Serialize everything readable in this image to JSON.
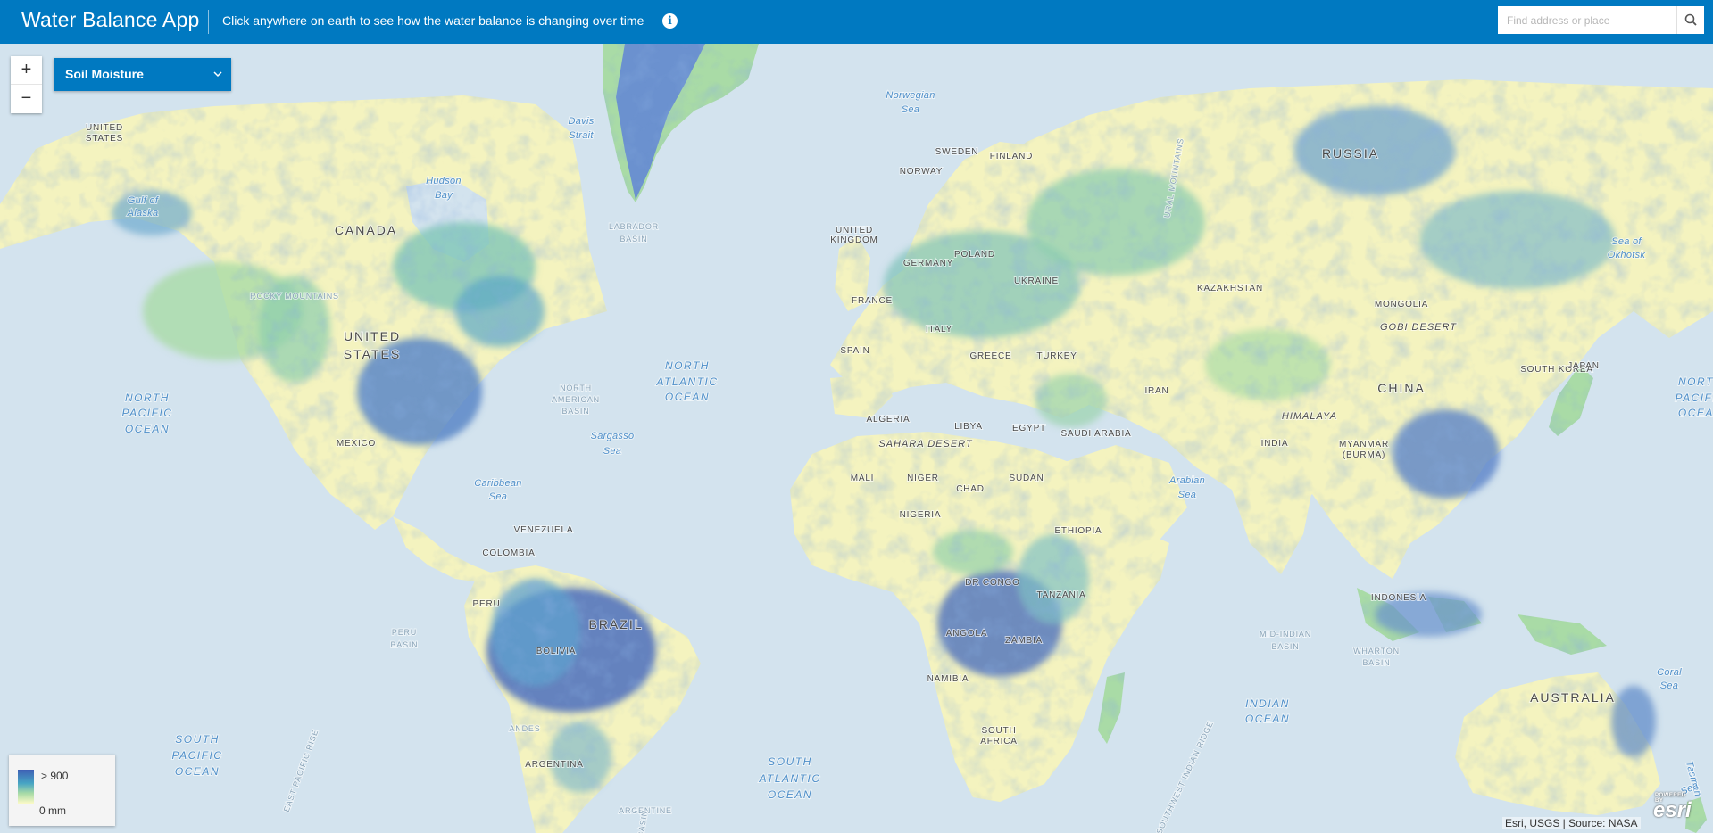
{
  "header": {
    "title": "Water Balance App",
    "subtitle": "Click anywhere on earth to see how the water balance is changing over time",
    "search_placeholder": "Find address or place"
  },
  "controls": {
    "zoom_in": "+",
    "zoom_out": "−",
    "layer_select": "Soil Moisture"
  },
  "legend": {
    "max_label": "> 900",
    "min_label": "0 mm"
  },
  "attribution": "Esri, USGS | Source: NASA",
  "logo": {
    "text": "esri",
    "small": "POWERED BY"
  },
  "colors": {
    "header": "#0079c1",
    "water": "#d3e3ee",
    "dry": "#fbf7c4",
    "moist": "#a9dba6",
    "wet": "#4d9fcb",
    "very_wet": "#3f63b6"
  },
  "map_labels": [
    {
      "t": "UNITED",
      "k": "country"
    },
    {
      "t": "STATES",
      "k": "country"
    },
    {
      "t": "Davis",
      "k": "water"
    },
    {
      "t": "Strait",
      "k": "water"
    },
    {
      "t": "Norwegian",
      "k": "water"
    },
    {
      "t": "Sea",
      "k": "water"
    },
    {
      "t": "Gulf of",
      "k": "water"
    },
    {
      "t": "Alaska",
      "k": "water"
    },
    {
      "t": "Hudson",
      "k": "water"
    },
    {
      "t": "Bay",
      "k": "water"
    },
    {
      "t": "CANADA",
      "k": "big"
    },
    {
      "t": "LABRADOR",
      "k": "basin"
    },
    {
      "t": "BASIN",
      "k": "basin"
    },
    {
      "t": "SWEDEN",
      "k": "country"
    },
    {
      "t": "FINLAND",
      "k": "country"
    },
    {
      "t": "NORWAY",
      "k": "country"
    },
    {
      "t": "RUSSIA",
      "k": "big"
    },
    {
      "t": "UNITED",
      "k": "country"
    },
    {
      "t": "KINGDOM",
      "k": "country"
    },
    {
      "t": "GERMANY",
      "k": "country"
    },
    {
      "t": "POLAND",
      "k": "country"
    },
    {
      "t": "UKRAINE",
      "k": "country"
    },
    {
      "t": "FRANCE",
      "k": "country"
    },
    {
      "t": "ITALY",
      "k": "country"
    },
    {
      "t": "SPAIN",
      "k": "country"
    },
    {
      "t": "GREECE",
      "k": "country"
    },
    {
      "t": "TURKEY",
      "k": "country"
    },
    {
      "t": "KAZAKHSTAN",
      "k": "country"
    },
    {
      "t": "MONGOLIA",
      "k": "country"
    },
    {
      "t": "GOBI DESERT",
      "k": "desert"
    },
    {
      "t": "Sea of",
      "k": "water"
    },
    {
      "t": "Okhotsk",
      "k": "water"
    },
    {
      "t": "SOUTH KOREA",
      "k": "country"
    },
    {
      "t": "JAPAN",
      "k": "country"
    },
    {
      "t": "CHINA",
      "k": "big"
    },
    {
      "t": "UNITED",
      "k": "big"
    },
    {
      "t": "STATES",
      "k": "big"
    },
    {
      "t": "NORTH",
      "k": "ocean"
    },
    {
      "t": "PACIFIC",
      "k": "ocean"
    },
    {
      "t": "OCEAN",
      "k": "ocean"
    },
    {
      "t": "NORTH",
      "k": "ocean"
    },
    {
      "t": "ATLANTIC",
      "k": "ocean"
    },
    {
      "t": "OCEAN",
      "k": "ocean"
    },
    {
      "t": "NORTH",
      "k": "basin"
    },
    {
      "t": "AMERICAN",
      "k": "basin"
    },
    {
      "t": "BASIN",
      "k": "basin"
    },
    {
      "t": "Sargasso",
      "k": "water"
    },
    {
      "t": "Sea",
      "k": "water"
    },
    {
      "t": "MEXICO",
      "k": "country"
    },
    {
      "t": "Caribbean",
      "k": "water"
    },
    {
      "t": "Sea",
      "k": "water"
    },
    {
      "t": "ALGERIA",
      "k": "country"
    },
    {
      "t": "LIBYA",
      "k": "country"
    },
    {
      "t": "EGYPT",
      "k": "country"
    },
    {
      "t": "SAHARA DESERT",
      "k": "desert"
    },
    {
      "t": "SAUDI ARABIA",
      "k": "country"
    },
    {
      "t": "IRAN",
      "k": "country"
    },
    {
      "t": "HIMALAYA",
      "k": "desert"
    },
    {
      "t": "INDIA",
      "k": "country"
    },
    {
      "t": "MYANMAR",
      "k": "country"
    },
    {
      "t": "(BURMA)",
      "k": "country"
    },
    {
      "t": "MALI",
      "k": "country"
    },
    {
      "t": "NIGER",
      "k": "country"
    },
    {
      "t": "CHAD",
      "k": "country"
    },
    {
      "t": "SUDAN",
      "k": "country"
    },
    {
      "t": "NIGERIA",
      "k": "country"
    },
    {
      "t": "ETHIOPIA",
      "k": "country"
    },
    {
      "t": "Arabian",
      "k": "water"
    },
    {
      "t": "Sea",
      "k": "water"
    },
    {
      "t": "VENEZUELA",
      "k": "country"
    },
    {
      "t": "COLOMBIA",
      "k": "country"
    },
    {
      "t": "PERU",
      "k": "country"
    },
    {
      "t": "BRAZIL",
      "k": "big"
    },
    {
      "t": "BOLIVIA",
      "k": "country"
    },
    {
      "t": "DR CONGO",
      "k": "country"
    },
    {
      "t": "TANZANIA",
      "k": "country"
    },
    {
      "t": "ANGOLA",
      "k": "country"
    },
    {
      "t": "ZAMBIA",
      "k": "country"
    },
    {
      "t": "NAMIBIA",
      "k": "country"
    },
    {
      "t": "SOUTH",
      "k": "country"
    },
    {
      "t": "AFRICA",
      "k": "country"
    },
    {
      "t": "INDONESIA",
      "k": "country"
    },
    {
      "t": "MID-INDIAN",
      "k": "basin"
    },
    {
      "t": "BASIN",
      "k": "basin"
    },
    {
      "t": "WHARTON",
      "k": "basin"
    },
    {
      "t": "BASIN",
      "k": "basin"
    },
    {
      "t": "Coral",
      "k": "water"
    },
    {
      "t": "Sea",
      "k": "water"
    },
    {
      "t": "AUSTRALIA",
      "k": "big"
    },
    {
      "t": "INDIAN",
      "k": "ocean"
    },
    {
      "t": "OCEAN",
      "k": "ocean"
    },
    {
      "t": "PERU",
      "k": "basin"
    },
    {
      "t": "BASIN",
      "k": "basin"
    },
    {
      "t": "SOUTH",
      "k": "ocean"
    },
    {
      "t": "PACIFIC",
      "k": "ocean"
    },
    {
      "t": "OCEAN",
      "k": "ocean"
    },
    {
      "t": "SOUTH",
      "k": "ocean"
    },
    {
      "t": "ATLANTIC",
      "k": "ocean"
    },
    {
      "t": "OCEAN",
      "k": "ocean"
    },
    {
      "t": "ARGENTINA",
      "k": "country"
    },
    {
      "t": "ARGENTINE",
      "k": "basin"
    },
    {
      "t": "BASIN",
      "k": "basin"
    },
    {
      "t": "Tasman",
      "k": "water"
    },
    {
      "t": "Sea",
      "k": "water"
    },
    {
      "t": "EAST PACIFIC RISE",
      "k": "basin"
    },
    {
      "t": "SOUTHWEST INDIAN RIDGE",
      "k": "basin"
    },
    {
      "t": "URAL MOUNTAINS",
      "k": "basin"
    },
    {
      "t": "ROCKY MOUNTAINS",
      "k": "basin"
    },
    {
      "t": "ANDES",
      "k": "basin"
    },
    {
      "t": "NORTH",
      "k": "ocean"
    },
    {
      "t": "PACIFIC",
      "k": "ocean"
    },
    {
      "t": "OCEAN",
      "k": "ocean"
    }
  ]
}
